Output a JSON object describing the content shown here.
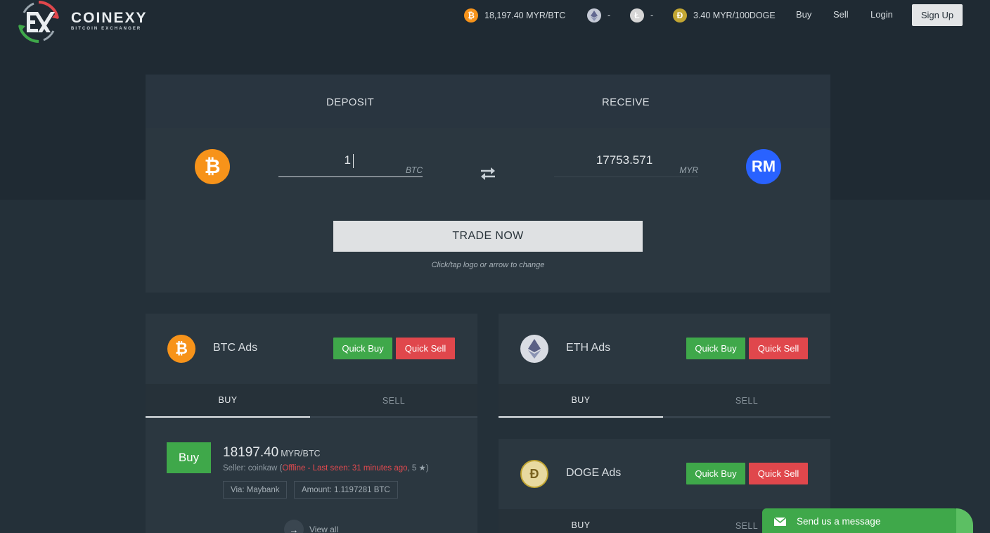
{
  "header": {
    "brand": "COINEXY",
    "tagline": "BITCOIN EXCHANGER",
    "tickers": [
      {
        "icon": "bitcoin-icon",
        "text": "18,197.40 MYR/BTC",
        "color": "#f7931a"
      },
      {
        "icon": "ethereum-icon",
        "text": "-",
        "color": "#8a93b2"
      },
      {
        "icon": "litecoin-icon",
        "text": "-",
        "color": "#bfbbbb"
      },
      {
        "icon": "dogecoin-icon",
        "text": "3.40 MYR/100DOGE",
        "color": "#c2a633"
      }
    ],
    "nav": {
      "buy": "Buy",
      "sell": "Sell",
      "login": "Login",
      "signup": "Sign Up"
    }
  },
  "exchanger": {
    "deposit_title": "DEPOSIT",
    "receive_title": "RECEIVE",
    "deposit_amount": "1",
    "deposit_unit": "BTC",
    "receive_amount": "17753.571",
    "receive_unit": "MYR",
    "receive_coin_label": "RM",
    "trade_button": "TRADE NOW",
    "hint": "Click/tap logo or arrow to change"
  },
  "ads": {
    "btc": {
      "title": "BTC Ads",
      "quick_buy": "Quick Buy",
      "quick_sell": "Quick Sell",
      "tab_buy": "BUY",
      "tab_sell": "SELL",
      "listing": {
        "action": "Buy",
        "price": "18197.40",
        "price_unit": "MYR/BTC",
        "seller_prefix": "Seller: coinkaw (",
        "status": "Offline - Last seen: 31 minutes ago",
        "rating": ", 5",
        "rating_suffix": ")",
        "via": "Via: Maybank",
        "amount": "Amount: 1.1197281 BTC"
      },
      "view_all": "View all"
    },
    "eth": {
      "title": "ETH Ads",
      "quick_buy": "Quick Buy",
      "quick_sell": "Quick Sell",
      "tab_buy": "BUY",
      "tab_sell": "SELL"
    },
    "doge": {
      "title": "DOGE Ads",
      "quick_buy": "Quick Buy",
      "quick_sell": "Quick Sell",
      "tab_buy": "BUY",
      "tab_sell": "SELL"
    }
  },
  "chat": {
    "label": "Send us a message"
  },
  "colors": {
    "accent_green": "#3fa84a",
    "accent_red": "#e0474c",
    "bitcoin_orange": "#f7931a",
    "rm_blue": "#2962ff"
  }
}
